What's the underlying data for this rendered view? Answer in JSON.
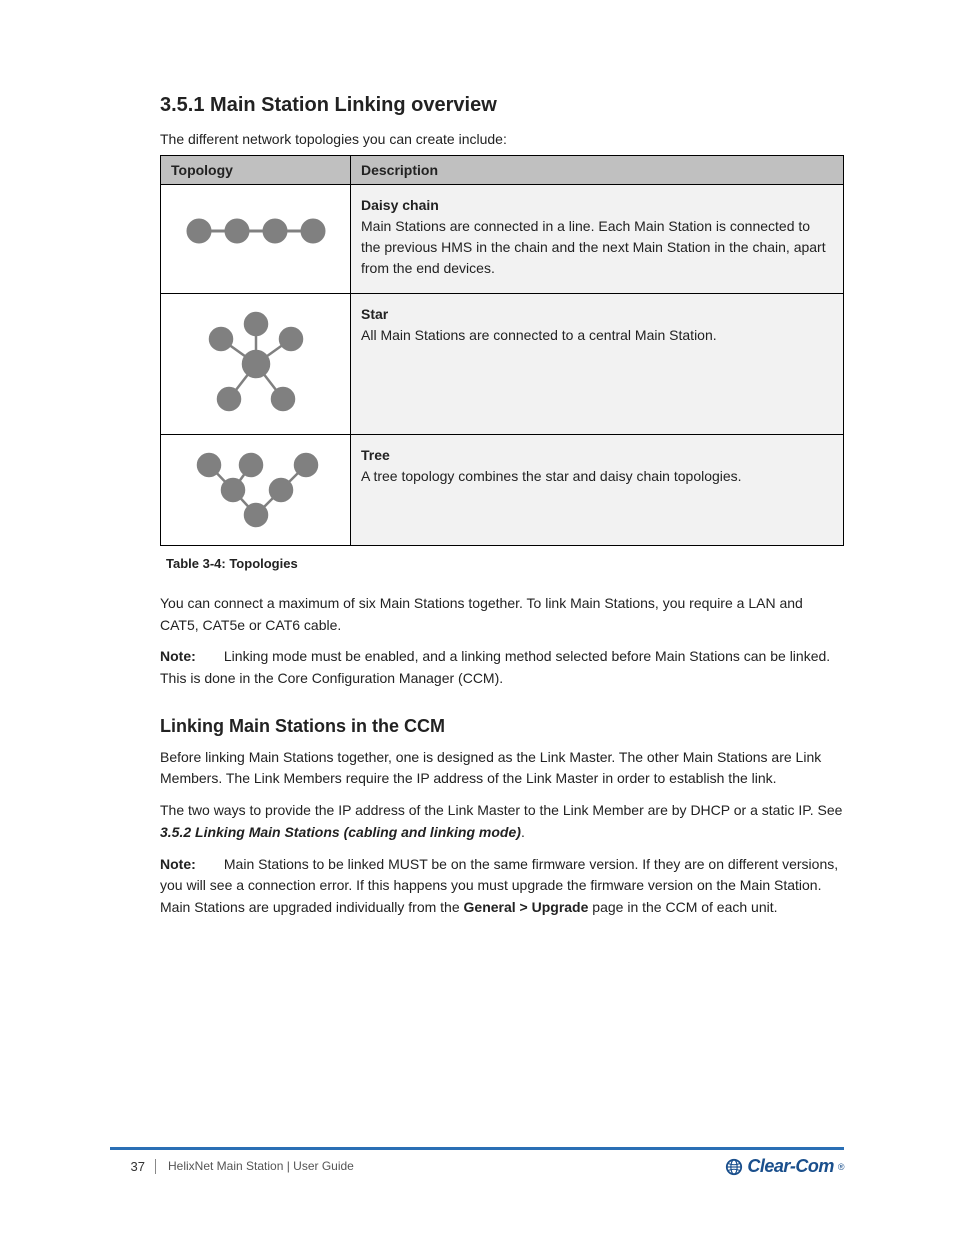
{
  "intro": {
    "line": "The different network topologies you can create include:"
  },
  "section_title": "3.5.1 Main Station Linking overview",
  "table": {
    "col1": "Topology",
    "col2": "Description",
    "rows": [
      {
        "title": "Daisy chain",
        "desc": "Main Stations are connected in a line. Each Main Station is connected to the previous HMS in the chain and the next Main Station in the chain, apart from the end devices."
      },
      {
        "title": "Star",
        "desc": "All Main Stations are connected to a central Main Station."
      },
      {
        "title": "Tree",
        "desc": "A tree topology combines the star and daisy chain topologies."
      }
    ],
    "caption": "Table 3-4: Topologies"
  },
  "post_para": "You can connect a maximum of six Main Stations together. To link Main Stations, you require a LAN and CAT5, CAT5e or CAT6 cable.",
  "note1": {
    "label": "Note:",
    "text": "Linking mode must be enabled, and a linking method selected before Main Stations can be linked. This is done in the Core Configuration Manager (CCM)."
  },
  "sub_title": "Linking Main Stations in the CCM",
  "sub_para1": "Before linking Main Stations together, one is designed as the Link Master. The other Main Stations are Link Members. The Link Members require the IP address of the Link Master in order to establish the link.",
  "sub_para2_a": "The two ways to provide the IP address of the Link Master to the Link Member are by DHCP or a static IP. See ",
  "sub_para2_ref": "3.5.2 Linking Main Stations (cabling and linking mode)",
  "sub_para2_b": ".",
  "note2": {
    "label": "Note:",
    "text": "Main Stations to be linked MUST be on the same firmware version. If they are on different versions, you will see a connection error. If this happens you must upgrade the firmware version on the Main Station. Main Stations are upgraded individually from the ",
    "bold": "General > Upgrade",
    "tail": " page in the CCM of each unit."
  },
  "footer": {
    "page": "37",
    "line1": "HelixNet Main Station | User Guide",
    "brand": "Clear-Com",
    "reg": "®"
  }
}
